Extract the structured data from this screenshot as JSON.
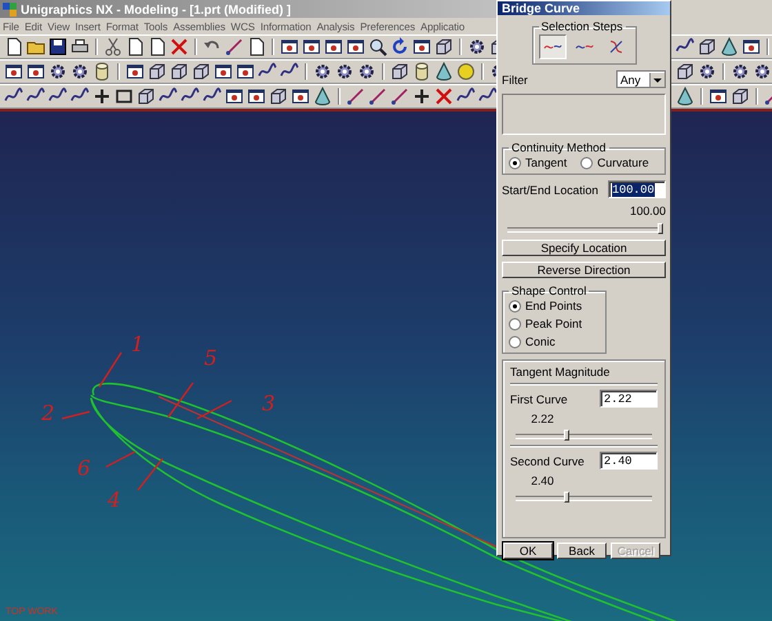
{
  "window": {
    "title": "Unigraphics NX - Modeling - [1.prt (Modified) ]"
  },
  "menu": [
    "File",
    "Edit",
    "View",
    "Insert",
    "Format",
    "Tools",
    "Assemblies",
    "WCS",
    "Information",
    "Analysis",
    "Preferences",
    "Applicatio"
  ],
  "viewport": {
    "annotations": [
      "1",
      "2",
      "3",
      "4",
      "5",
      "6"
    ],
    "view_label": "TOP WORK"
  },
  "dialog": {
    "title": "Bridge Curve",
    "selection_steps": {
      "label": "Selection Steps",
      "steps": [
        {
          "selected": true
        },
        {
          "selected": false
        },
        {
          "selected": false
        }
      ]
    },
    "filter": {
      "label": "Filter",
      "value": "Any"
    },
    "continuity_method": {
      "label": "Continuity Method",
      "options": [
        {
          "label": "Tangent",
          "selected": true
        },
        {
          "label": "Curvature",
          "selected": false
        }
      ]
    },
    "start_end_location": {
      "label": "Start/End Location",
      "value": "100.00",
      "highlighted": true,
      "reading": "100.00",
      "level": 1.0
    },
    "buttons": [
      {
        "label": "Specify Location"
      },
      {
        "label": "Reverse Direction"
      }
    ],
    "shape_control": {
      "label": "Shape Control",
      "options": [
        {
          "label": "End Points",
          "selected": true
        },
        {
          "label": "Peak Point",
          "selected": false
        },
        {
          "label": "Conic",
          "selected": false
        }
      ]
    },
    "tangent_magnitude": {
      "label": "Tangent Magnitude",
      "curves": [
        {
          "label": "First Curve",
          "value": "2.22",
          "reading": "2.22",
          "level": 0.37
        },
        {
          "label": "Second Curve",
          "value": "2.40",
          "reading": "2.40",
          "level": 0.37
        }
      ]
    },
    "footer_buttons": [
      {
        "label": "OK",
        "disabled": false
      },
      {
        "label": "Back",
        "disabled": false
      },
      {
        "label": "Cancel",
        "disabled": true
      }
    ]
  }
}
